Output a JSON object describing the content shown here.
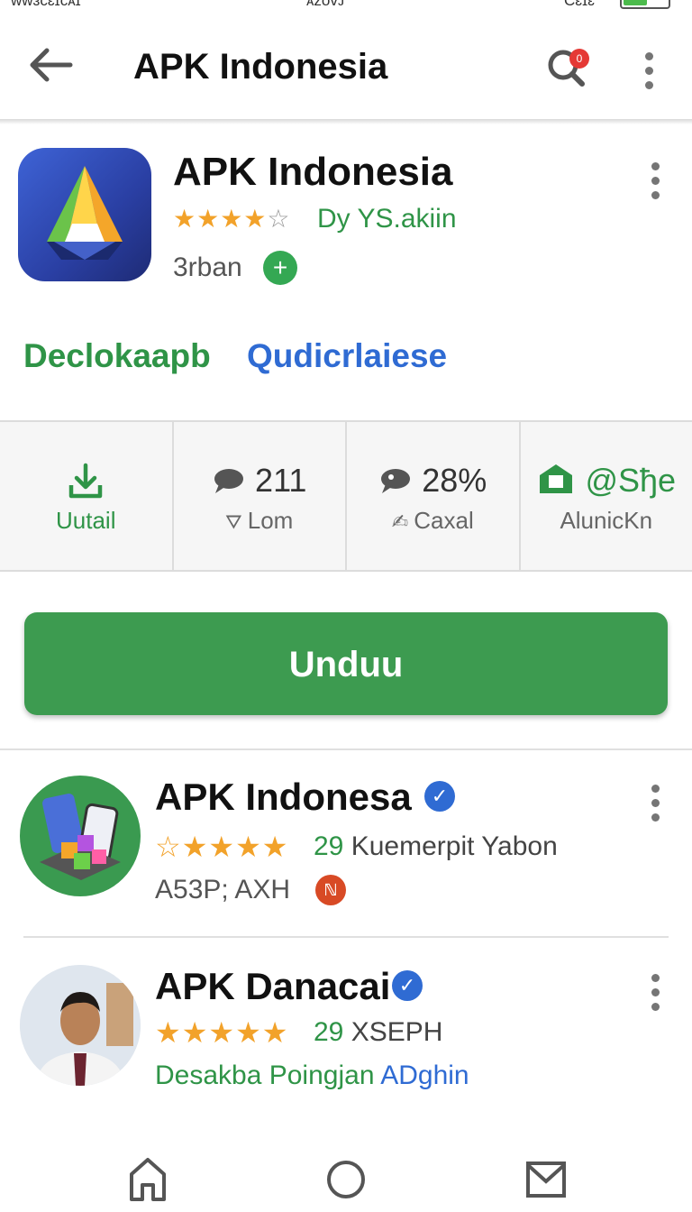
{
  "status_bar": {
    "left_text": "ᴡᴡɜᴄɛɪᴄᴀɪ",
    "center_text": "ᴀᴢᴏᴠᴊ",
    "right_text": "Cɛɪɛ"
  },
  "app_bar": {
    "title": "APK Indonesia",
    "search_badge": "0"
  },
  "hero": {
    "title": "APK Indonesia",
    "rating": 4,
    "stars_on": "★★★★",
    "stars_off": "☆",
    "developer": "Dy YS.akiin",
    "subtext": "3rban",
    "plus_symbol": "+",
    "link_primary": "Declokaapb",
    "link_secondary": "Qudicrlaiese"
  },
  "stats": [
    {
      "top": "",
      "bottom": "Uutail",
      "icon": "download-icon"
    },
    {
      "top": "211",
      "bottom": "Lom",
      "icon": "chat-icon"
    },
    {
      "top": "28%",
      "bottom": "Caxal",
      "icon": "chat-icon"
    },
    {
      "top": "@Sђe",
      "bottom": "AlunicKn",
      "icon": "home-icon"
    }
  ],
  "download_button": {
    "label": "Unduu"
  },
  "list": [
    {
      "title": "APK Indonesa",
      "verified": "✓",
      "stars": "☆★★★★",
      "count": "29",
      "meta": "Kuemerpit Yabon",
      "sub": "A53P; AXH",
      "badge": "ℕ"
    },
    {
      "title": "APK Danacai",
      "verified": "✓",
      "stars": "★★★★★",
      "count": "29",
      "meta": "XSEPH",
      "sub_green": "Desakba Poingjan",
      "sub_blue": "ADghin"
    }
  ],
  "colors": {
    "green": "#3d9b50",
    "blue": "#2f6bd3",
    "star": "#f2a22a",
    "badge_red": "#e53935"
  }
}
